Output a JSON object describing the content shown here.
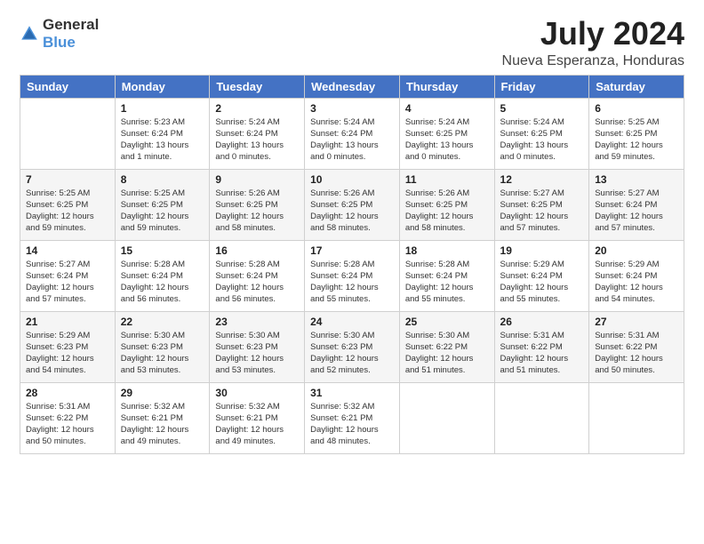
{
  "logo": {
    "general": "General",
    "blue": "Blue"
  },
  "title": "July 2024",
  "subtitle": "Nueva Esperanza, Honduras",
  "days_of_week": [
    "Sunday",
    "Monday",
    "Tuesday",
    "Wednesday",
    "Thursday",
    "Friday",
    "Saturday"
  ],
  "weeks": [
    [
      {
        "day": "",
        "sunrise": "",
        "sunset": "",
        "daylight": ""
      },
      {
        "day": "1",
        "sunrise": "Sunrise: 5:23 AM",
        "sunset": "Sunset: 6:24 PM",
        "daylight": "Daylight: 13 hours and 1 minute."
      },
      {
        "day": "2",
        "sunrise": "Sunrise: 5:24 AM",
        "sunset": "Sunset: 6:24 PM",
        "daylight": "Daylight: 13 hours and 0 minutes."
      },
      {
        "day": "3",
        "sunrise": "Sunrise: 5:24 AM",
        "sunset": "Sunset: 6:24 PM",
        "daylight": "Daylight: 13 hours and 0 minutes."
      },
      {
        "day": "4",
        "sunrise": "Sunrise: 5:24 AM",
        "sunset": "Sunset: 6:25 PM",
        "daylight": "Daylight: 13 hours and 0 minutes."
      },
      {
        "day": "5",
        "sunrise": "Sunrise: 5:24 AM",
        "sunset": "Sunset: 6:25 PM",
        "daylight": "Daylight: 13 hours and 0 minutes."
      },
      {
        "day": "6",
        "sunrise": "Sunrise: 5:25 AM",
        "sunset": "Sunset: 6:25 PM",
        "daylight": "Daylight: 12 hours and 59 minutes."
      }
    ],
    [
      {
        "day": "7",
        "sunrise": "Sunrise: 5:25 AM",
        "sunset": "Sunset: 6:25 PM",
        "daylight": "Daylight: 12 hours and 59 minutes."
      },
      {
        "day": "8",
        "sunrise": "Sunrise: 5:25 AM",
        "sunset": "Sunset: 6:25 PM",
        "daylight": "Daylight: 12 hours and 59 minutes."
      },
      {
        "day": "9",
        "sunrise": "Sunrise: 5:26 AM",
        "sunset": "Sunset: 6:25 PM",
        "daylight": "Daylight: 12 hours and 58 minutes."
      },
      {
        "day": "10",
        "sunrise": "Sunrise: 5:26 AM",
        "sunset": "Sunset: 6:25 PM",
        "daylight": "Daylight: 12 hours and 58 minutes."
      },
      {
        "day": "11",
        "sunrise": "Sunrise: 5:26 AM",
        "sunset": "Sunset: 6:25 PM",
        "daylight": "Daylight: 12 hours and 58 minutes."
      },
      {
        "day": "12",
        "sunrise": "Sunrise: 5:27 AM",
        "sunset": "Sunset: 6:25 PM",
        "daylight": "Daylight: 12 hours and 57 minutes."
      },
      {
        "day": "13",
        "sunrise": "Sunrise: 5:27 AM",
        "sunset": "Sunset: 6:24 PM",
        "daylight": "Daylight: 12 hours and 57 minutes."
      }
    ],
    [
      {
        "day": "14",
        "sunrise": "Sunrise: 5:27 AM",
        "sunset": "Sunset: 6:24 PM",
        "daylight": "Daylight: 12 hours and 57 minutes."
      },
      {
        "day": "15",
        "sunrise": "Sunrise: 5:28 AM",
        "sunset": "Sunset: 6:24 PM",
        "daylight": "Daylight: 12 hours and 56 minutes."
      },
      {
        "day": "16",
        "sunrise": "Sunrise: 5:28 AM",
        "sunset": "Sunset: 6:24 PM",
        "daylight": "Daylight: 12 hours and 56 minutes."
      },
      {
        "day": "17",
        "sunrise": "Sunrise: 5:28 AM",
        "sunset": "Sunset: 6:24 PM",
        "daylight": "Daylight: 12 hours and 55 minutes."
      },
      {
        "day": "18",
        "sunrise": "Sunrise: 5:28 AM",
        "sunset": "Sunset: 6:24 PM",
        "daylight": "Daylight: 12 hours and 55 minutes."
      },
      {
        "day": "19",
        "sunrise": "Sunrise: 5:29 AM",
        "sunset": "Sunset: 6:24 PM",
        "daylight": "Daylight: 12 hours and 55 minutes."
      },
      {
        "day": "20",
        "sunrise": "Sunrise: 5:29 AM",
        "sunset": "Sunset: 6:24 PM",
        "daylight": "Daylight: 12 hours and 54 minutes."
      }
    ],
    [
      {
        "day": "21",
        "sunrise": "Sunrise: 5:29 AM",
        "sunset": "Sunset: 6:23 PM",
        "daylight": "Daylight: 12 hours and 54 minutes."
      },
      {
        "day": "22",
        "sunrise": "Sunrise: 5:30 AM",
        "sunset": "Sunset: 6:23 PM",
        "daylight": "Daylight: 12 hours and 53 minutes."
      },
      {
        "day": "23",
        "sunrise": "Sunrise: 5:30 AM",
        "sunset": "Sunset: 6:23 PM",
        "daylight": "Daylight: 12 hours and 53 minutes."
      },
      {
        "day": "24",
        "sunrise": "Sunrise: 5:30 AM",
        "sunset": "Sunset: 6:23 PM",
        "daylight": "Daylight: 12 hours and 52 minutes."
      },
      {
        "day": "25",
        "sunrise": "Sunrise: 5:30 AM",
        "sunset": "Sunset: 6:22 PM",
        "daylight": "Daylight: 12 hours and 51 minutes."
      },
      {
        "day": "26",
        "sunrise": "Sunrise: 5:31 AM",
        "sunset": "Sunset: 6:22 PM",
        "daylight": "Daylight: 12 hours and 51 minutes."
      },
      {
        "day": "27",
        "sunrise": "Sunrise: 5:31 AM",
        "sunset": "Sunset: 6:22 PM",
        "daylight": "Daylight: 12 hours and 50 minutes."
      }
    ],
    [
      {
        "day": "28",
        "sunrise": "Sunrise: 5:31 AM",
        "sunset": "Sunset: 6:22 PM",
        "daylight": "Daylight: 12 hours and 50 minutes."
      },
      {
        "day": "29",
        "sunrise": "Sunrise: 5:32 AM",
        "sunset": "Sunset: 6:21 PM",
        "daylight": "Daylight: 12 hours and 49 minutes."
      },
      {
        "day": "30",
        "sunrise": "Sunrise: 5:32 AM",
        "sunset": "Sunset: 6:21 PM",
        "daylight": "Daylight: 12 hours and 49 minutes."
      },
      {
        "day": "31",
        "sunrise": "Sunrise: 5:32 AM",
        "sunset": "Sunset: 6:21 PM",
        "daylight": "Daylight: 12 hours and 48 minutes."
      },
      {
        "day": "",
        "sunrise": "",
        "sunset": "",
        "daylight": ""
      },
      {
        "day": "",
        "sunrise": "",
        "sunset": "",
        "daylight": ""
      },
      {
        "day": "",
        "sunrise": "",
        "sunset": "",
        "daylight": ""
      }
    ]
  ]
}
